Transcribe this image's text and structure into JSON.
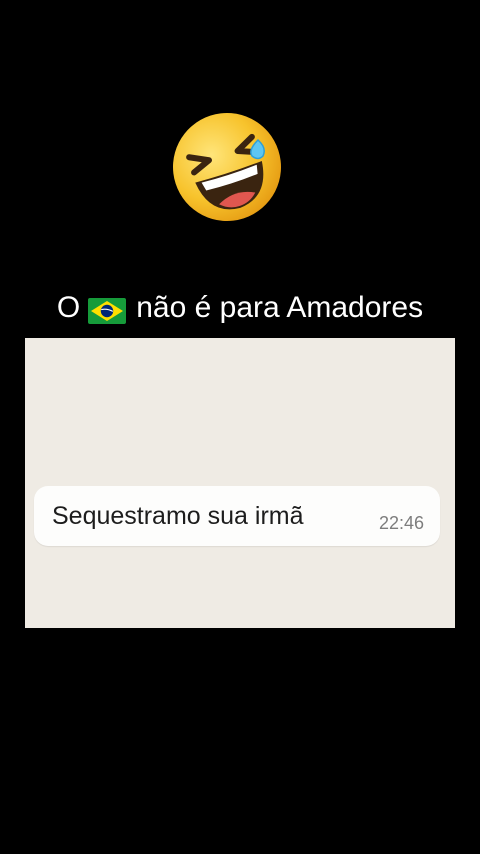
{
  "caption": {
    "prefix": "O",
    "flag_icon": "brazil-flag-icon",
    "suffix": "não é para Amadores"
  },
  "top_emoji": {
    "icon": "rolling-on-the-floor-laughing-emoji"
  },
  "message": {
    "text": "Sequestramo sua irmã",
    "time": "22:46"
  },
  "colors": {
    "background": "#000000",
    "chat_background": "#efebe4",
    "bubble": "#fdfdfc",
    "flag_green": "#169b3a",
    "flag_yellow": "#fedf00",
    "flag_blue": "#002776",
    "emoji_yellow": "#f7c32c"
  }
}
